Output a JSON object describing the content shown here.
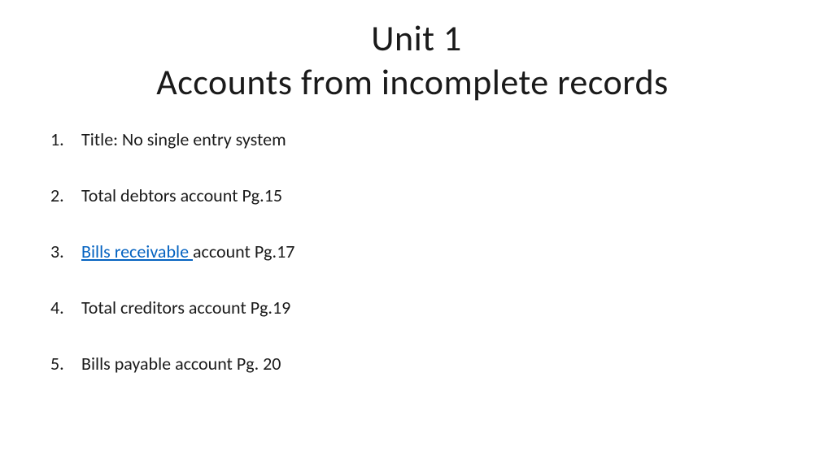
{
  "title": {
    "line1": "Unit 1",
    "line2": "Accounts from incomplete records"
  },
  "items": [
    {
      "marker": "1.",
      "text": "Title: No single entry system"
    },
    {
      "marker": "2.",
      "text": "Total debtors account Pg.15"
    },
    {
      "marker": "3.",
      "link": "Bills receivable ",
      "rest": "account Pg.17"
    },
    {
      "marker": "4.",
      "text": "Total creditors account Pg.19"
    },
    {
      "marker": "5.",
      "text": "Bills payable account Pg. 20"
    }
  ]
}
